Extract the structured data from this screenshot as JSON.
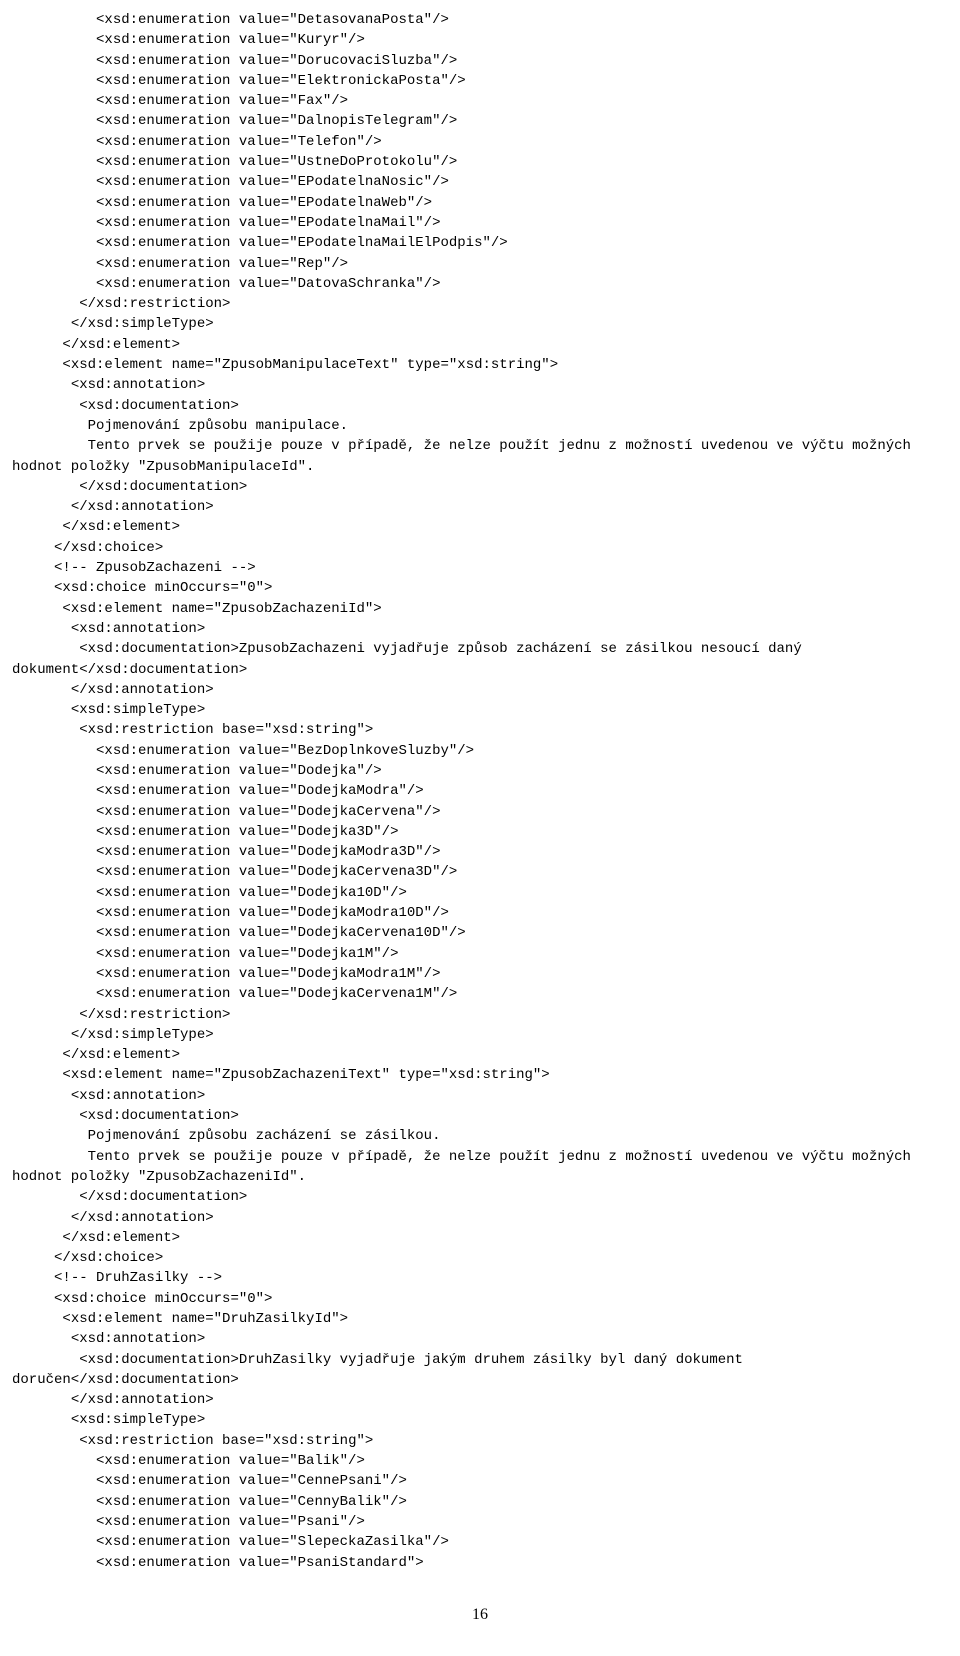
{
  "code": "          <xsd:enumeration value=\"DetasovanaPosta\"/>\n          <xsd:enumeration value=\"Kuryr\"/>\n          <xsd:enumeration value=\"DorucovaciSluzba\"/>\n          <xsd:enumeration value=\"ElektronickaPosta\"/>\n          <xsd:enumeration value=\"Fax\"/>\n          <xsd:enumeration value=\"DalnopisTelegram\"/>\n          <xsd:enumeration value=\"Telefon\"/>\n          <xsd:enumeration value=\"UstneDoProtokolu\"/>\n          <xsd:enumeration value=\"EPodatelnaNosic\"/>\n          <xsd:enumeration value=\"EPodatelnaWeb\"/>\n          <xsd:enumeration value=\"EPodatelnaMail\"/>\n          <xsd:enumeration value=\"EPodatelnaMailElPodpis\"/>\n          <xsd:enumeration value=\"Rep\"/>\n          <xsd:enumeration value=\"DatovaSchranka\"/>\n        </xsd:restriction>\n       </xsd:simpleType>\n      </xsd:element>\n      <xsd:element name=\"ZpusobManipulaceText\" type=\"xsd:string\">\n       <xsd:annotation>\n        <xsd:documentation>\n         Pojmenování způsobu manipulace.\n         Tento prvek se použije pouze v případě, že nelze použít jednu z možností uvedenou ve výčtu možných hodnot položky \"ZpusobManipulaceId\".\n        </xsd:documentation>\n       </xsd:annotation>\n      </xsd:element>\n     </xsd:choice>\n     <!-- ZpusobZachazeni -->\n     <xsd:choice minOccurs=\"0\">\n      <xsd:element name=\"ZpusobZachazeniId\">\n       <xsd:annotation>\n        <xsd:documentation>ZpusobZachazeni vyjadřuje způsob zacházení se zásilkou nesoucí daný dokument</xsd:documentation>\n       </xsd:annotation>\n       <xsd:simpleType>\n        <xsd:restriction base=\"xsd:string\">\n          <xsd:enumeration value=\"BezDoplnkoveSluzby\"/>\n          <xsd:enumeration value=\"Dodejka\"/>\n          <xsd:enumeration value=\"DodejkaModra\"/>\n          <xsd:enumeration value=\"DodejkaCervena\"/>\n          <xsd:enumeration value=\"Dodejka3D\"/>\n          <xsd:enumeration value=\"DodejkaModra3D\"/>\n          <xsd:enumeration value=\"DodejkaCervena3D\"/>\n          <xsd:enumeration value=\"Dodejka10D\"/>\n          <xsd:enumeration value=\"DodejkaModra10D\"/>\n          <xsd:enumeration value=\"DodejkaCervena10D\"/>\n          <xsd:enumeration value=\"Dodejka1M\"/>\n          <xsd:enumeration value=\"DodejkaModra1M\"/>\n          <xsd:enumeration value=\"DodejkaCervena1M\"/>\n        </xsd:restriction>\n       </xsd:simpleType>\n      </xsd:element>\n      <xsd:element name=\"ZpusobZachazeniText\" type=\"xsd:string\">\n       <xsd:annotation>\n        <xsd:documentation>\n         Pojmenování způsobu zacházení se zásilkou.\n         Tento prvek se použije pouze v případě, že nelze použít jednu z možností uvedenou ve výčtu možných hodnot položky \"ZpusobZachazeniId\".\n        </xsd:documentation>\n       </xsd:annotation>\n      </xsd:element>\n     </xsd:choice>\n     <!-- DruhZasilky -->\n     <xsd:choice minOccurs=\"0\">\n      <xsd:element name=\"DruhZasilkyId\">\n       <xsd:annotation>\n        <xsd:documentation>DruhZasilky vyjadřuje jakým druhem zásilky byl daný dokument doručen</xsd:documentation>\n       </xsd:annotation>\n       <xsd:simpleType>\n        <xsd:restriction base=\"xsd:string\">\n          <xsd:enumeration value=\"Balik\"/>\n          <xsd:enumeration value=\"CennePsani\"/>\n          <xsd:enumeration value=\"CennyBalik\"/>\n          <xsd:enumeration value=\"Psani\"/>\n          <xsd:enumeration value=\"SlepeckaZasilka\"/>\n          <xsd:enumeration value=\"PsaniStandard\">",
  "page_number": "16"
}
